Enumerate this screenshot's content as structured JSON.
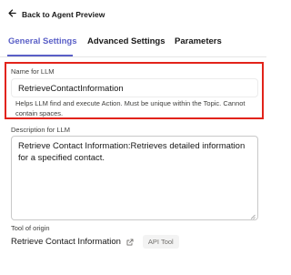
{
  "header": {
    "back_label": "Back to Agent Preview"
  },
  "tabs": [
    {
      "label": "General Settings",
      "active": true
    },
    {
      "label": "Advanced Settings",
      "active": false
    },
    {
      "label": "Parameters",
      "active": false
    }
  ],
  "form": {
    "name": {
      "label": "Name for LLM",
      "value": "RetrieveContactInformation",
      "help": "Helps LLM find and execute Action. Must be unique within the Topic. Cannot contain spaces."
    },
    "description": {
      "label": "Description for LLM",
      "value": "Retrieve Contact Information:Retrieves detailed information for a specified contact."
    },
    "tool_of_origin": {
      "label": "Tool of origin",
      "name": "Retrieve Contact Information",
      "badge": "API Tool"
    }
  },
  "colors": {
    "accent": "#5a5fc7",
    "highlight": "#e2231a"
  },
  "icons": {
    "back": "arrow-left-icon",
    "external": "external-link-icon"
  }
}
